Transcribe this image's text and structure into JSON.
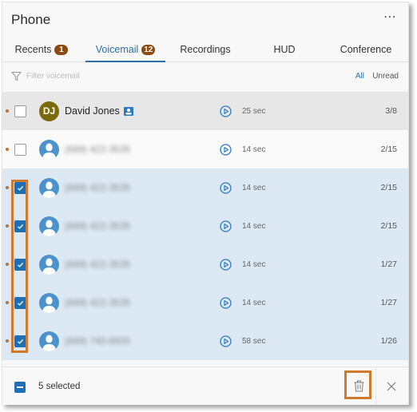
{
  "header": {
    "title": "Phone",
    "more_icon": "more-horizontal-icon"
  },
  "tabs": [
    {
      "label": "Recents",
      "badge": "1",
      "active": false
    },
    {
      "label": "Voicemail",
      "badge": "12",
      "active": true
    },
    {
      "label": "Recordings",
      "badge": null,
      "active": false
    },
    {
      "label": "HUD",
      "badge": null,
      "active": false
    },
    {
      "label": "Conference",
      "badge": null,
      "active": false
    }
  ],
  "filter": {
    "placeholder": "Filter voicemail",
    "value": "",
    "options": [
      "All",
      "Unread"
    ],
    "selected": "All"
  },
  "voicemails": [
    {
      "name": "David Jones",
      "initials": "DJ",
      "has_contact_card": true,
      "redacted": false,
      "duration": "25 sec",
      "date": "3/8",
      "unread": true,
      "checked": false
    },
    {
      "name": "(689) 422-3535",
      "redacted": true,
      "duration": "14 sec",
      "date": "2/15",
      "unread": true,
      "checked": false
    },
    {
      "name": "(689) 422-3535",
      "redacted": true,
      "duration": "14 sec",
      "date": "2/15",
      "unread": true,
      "checked": true
    },
    {
      "name": "(689) 422-3535",
      "redacted": true,
      "duration": "14 sec",
      "date": "2/15",
      "unread": true,
      "checked": true
    },
    {
      "name": "(689) 422-3535",
      "redacted": true,
      "duration": "14 sec",
      "date": "1/27",
      "unread": true,
      "checked": true
    },
    {
      "name": "(689) 422-3535",
      "redacted": true,
      "duration": "14 sec",
      "date": "1/27",
      "unread": true,
      "checked": true
    },
    {
      "name": "(689) 740-6600",
      "redacted": true,
      "duration": "58 sec",
      "date": "1/26",
      "unread": true,
      "checked": true
    }
  ],
  "footer": {
    "selected_label": "5 selected",
    "delete_icon": "trash-icon",
    "close_icon": "close-icon"
  },
  "colors": {
    "accent": "#2a6fa8",
    "badge": "#8a4a10",
    "highlight": "#d27a2c",
    "selected_row": "#dce8f3"
  }
}
